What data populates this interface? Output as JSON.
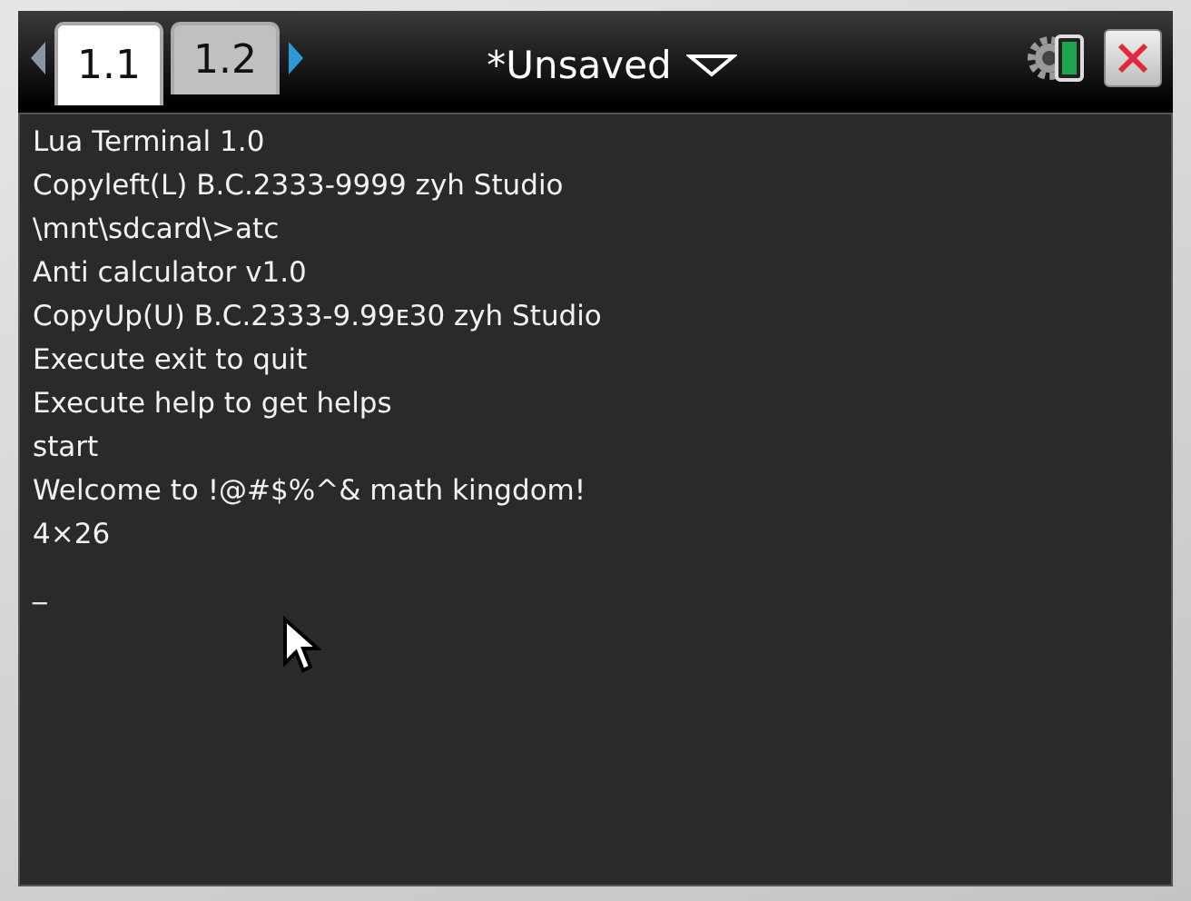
{
  "toolbar": {
    "tabs": [
      {
        "label": "1.1",
        "selected": true
      },
      {
        "label": "1.2",
        "selected": false
      }
    ],
    "document_title": "*Unsaved"
  },
  "terminal": {
    "lines": [
      "Lua Terminal 1.0",
      "Copyleft(L) B.C.2333-9999 zyh Studio",
      "\\mnt\\sdcard\\>atc",
      "Anti calculator v1.0",
      "CopyUp(U) B.C.2333-9.99ᴇ30 zyh Studio",
      "Execute exit to quit",
      "Execute help to get helps",
      "start",
      "Welcome to !@#$%^& math kingdom!",
      "4×26"
    ],
    "cursor": "_"
  }
}
